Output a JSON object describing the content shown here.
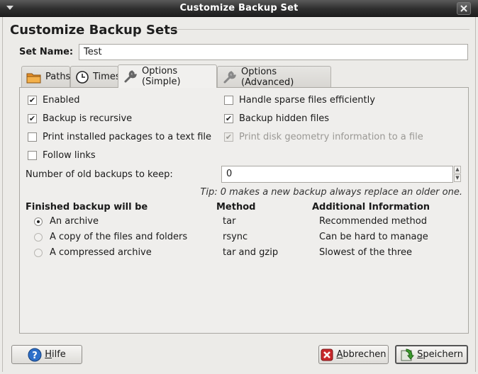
{
  "window": {
    "title": "Customize Backup Set"
  },
  "heading": "Customize Backup Sets",
  "set_name": {
    "label": "Set Name:",
    "value": "Test"
  },
  "tabs": [
    {
      "label": "Paths",
      "icon": "folder-icon",
      "active": false
    },
    {
      "label": "Times",
      "icon": "clock-icon",
      "active": false
    },
    {
      "label": "Options (Simple)",
      "icon": "wrench-icon",
      "active": true
    },
    {
      "label": "Options (Advanced)",
      "icon": "wrench-icon",
      "active": false
    }
  ],
  "options": {
    "enabled": {
      "label": "Enabled",
      "checked": true
    },
    "recursive": {
      "label": "Backup is recursive",
      "checked": true
    },
    "print_packages": {
      "label": "Print installed packages to a text file",
      "checked": false
    },
    "follow_links": {
      "label": "Follow links",
      "checked": false
    },
    "sparse": {
      "label": "Handle sparse files efficiently",
      "checked": false
    },
    "hidden": {
      "label": "Backup hidden files",
      "checked": true
    },
    "disk_geometry": {
      "label": "Print disk geometry information to a file",
      "checked": true,
      "disabled": true
    }
  },
  "old_backups": {
    "label": "Number of old backups to keep:",
    "value": "0"
  },
  "tip": "Tip: 0 makes a new backup always replace an older one.",
  "format_table": {
    "headers": [
      "Finished backup will be",
      "Method",
      "Additional Information"
    ],
    "rows": [
      {
        "label": "An archive",
        "method": "tar",
        "info": "Recommended method",
        "selected": true
      },
      {
        "label": "A copy of the files and folders",
        "method": "rsync",
        "info": "Can be hard to manage",
        "selected": false
      },
      {
        "label": "A compressed archive",
        "method": "tar and gzip",
        "info": "Slowest of the three",
        "selected": false
      }
    ]
  },
  "buttons": {
    "help": {
      "mnemonic": "H",
      "rest": "ilfe"
    },
    "cancel": {
      "mnemonic": "A",
      "rest": "bbrechen"
    },
    "save": {
      "mnemonic": "S",
      "rest": "peichern"
    }
  },
  "colors": {
    "accent_green": "#3c9a2e",
    "cancel_red": "#c8282b",
    "help_blue": "#2e6fc9"
  }
}
